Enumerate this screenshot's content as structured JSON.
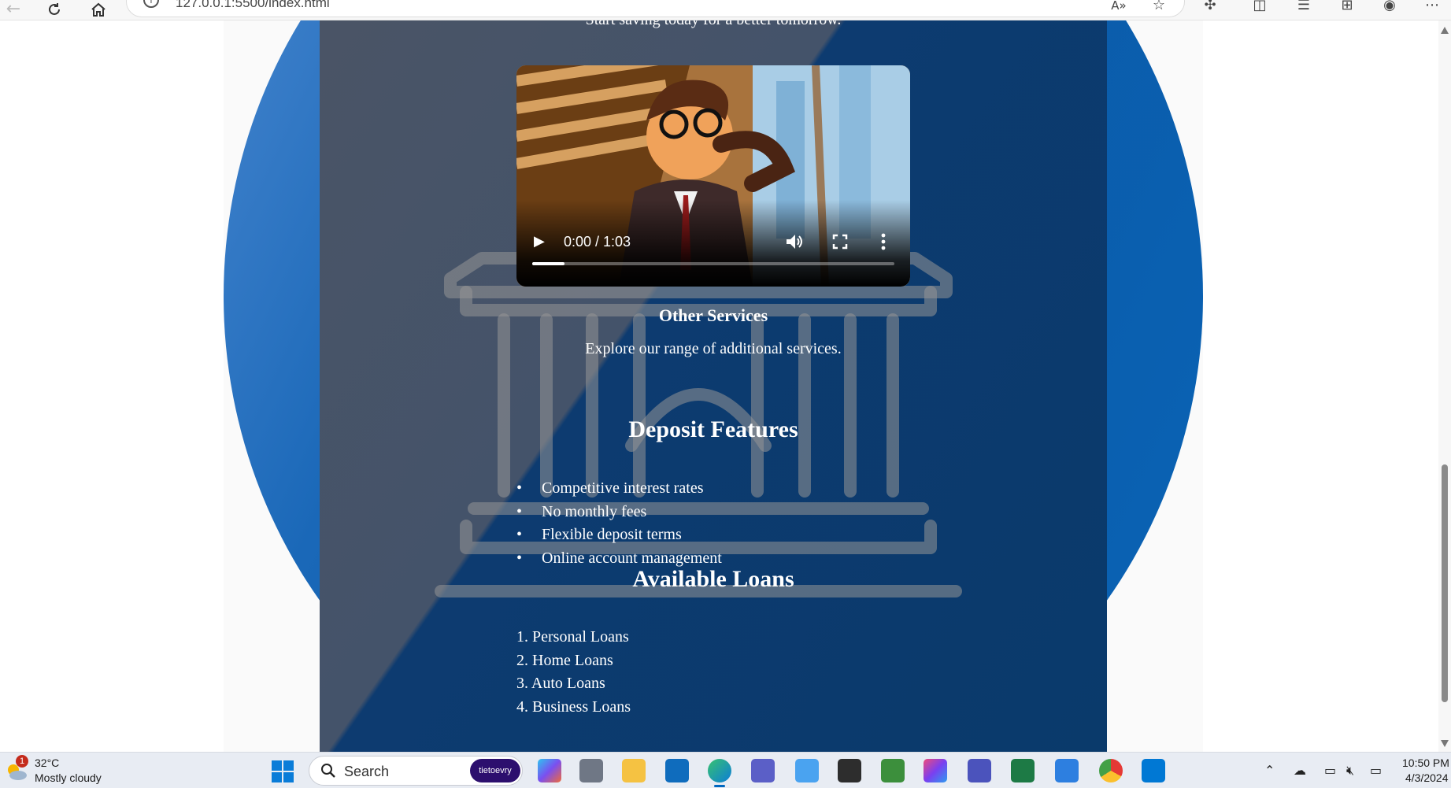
{
  "browser": {
    "url": "127.0.0.1:5500/index.html",
    "back_icon": "arrow-left",
    "refresh_icon": "refresh",
    "home_icon": "home",
    "read_aloud_label": "A»"
  },
  "page": {
    "tagline": "Start saving today for a better tomorrow.",
    "video": {
      "time": "0:00 / 1:03",
      "progress": 0.09
    },
    "other_services": {
      "title": "Other Services",
      "description": "Explore our range of additional services."
    },
    "deposit_features": {
      "title": "Deposit Features",
      "items": [
        "Competitive interest rates",
        "No monthly fees",
        "Flexible deposit terms",
        "Online account management"
      ]
    },
    "available_loans": {
      "title": "Available Loans",
      "items": [
        "1. Personal Loans",
        "2. Home Loans",
        "3. Auto Loans",
        "4. Business Loans"
      ]
    },
    "colors": {
      "panel_dark": "#0a3a6b",
      "circle_blue": "#0b5aa8"
    }
  },
  "taskbar": {
    "weather": {
      "badge": "1",
      "temp": "32°C",
      "desc": "Mostly cloudy"
    },
    "search": {
      "label": "Search",
      "brand": "tietoevry"
    },
    "clock": {
      "time": "10:50 PM",
      "date": "4/3/2024"
    }
  }
}
